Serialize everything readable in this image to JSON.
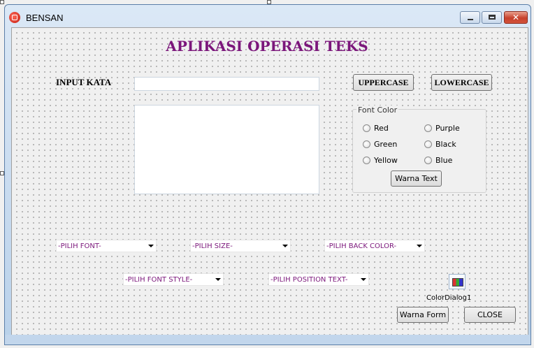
{
  "window": {
    "title": "BENSAN",
    "close_glyph": "✕"
  },
  "form": {
    "heading": "APLIKASI OPERASI TEKS",
    "input_label": "INPUT KATA",
    "input_value": "",
    "output_value": "",
    "uppercase_button": "UPPERCASE",
    "lowercase_button": "LOWERCASE",
    "font_color_group": {
      "caption": "Font Color",
      "options": [
        "Red",
        "Purple",
        "Green",
        "Black",
        "Yellow",
        "Blue"
      ],
      "apply_button": "Warna Text"
    },
    "dropdowns": {
      "font": "-PILIH FONT-",
      "size": "-PILIH SIZE-",
      "back_color": "-PILIH BACK COLOR-",
      "font_style": "-PILIH FONT STYLE-",
      "position_text": "-PILIH POSITION TEXT-"
    },
    "color_dialog_label": "ColorDialog1",
    "form_color_button": "Warna Form",
    "close_button": "CLOSE"
  },
  "colors": {
    "heading": "#7b167b",
    "dropdown_text": "#7b167b",
    "window_frame": "#b9d1ea"
  }
}
